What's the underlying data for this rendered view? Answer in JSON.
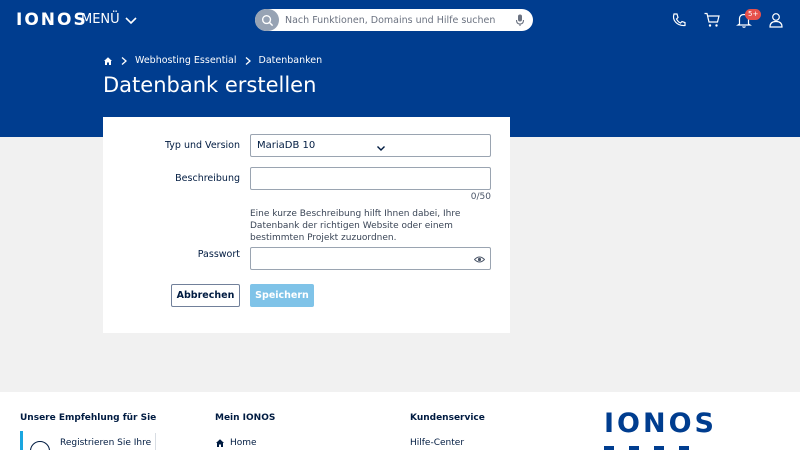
{
  "header": {
    "logo": "IONOS",
    "menu_label": "MENÜ",
    "search_placeholder": "Nach Funktionen, Domains und Hilfe suchen",
    "notification_badge": "5+"
  },
  "breadcrumb": {
    "items": [
      "Webhosting Essential",
      "Datenbanken"
    ]
  },
  "page": {
    "title": "Datenbank erstellen"
  },
  "form": {
    "type_label": "Typ und Version",
    "type_value": "MariaDB 10",
    "description_label": "Beschreibung",
    "description_value": "",
    "description_counter": "0/50",
    "description_help": "Eine kurze Beschreibung hilft Ihnen dabei, Ihre Datenbank der richtigen Website oder einem bestimmten Projekt zuzuordnen.",
    "password_label": "Passwort",
    "password_value": "",
    "cancel_label": "Abbrechen",
    "save_label": "Speichern"
  },
  "footer": {
    "col1_heading": "Unsere Empfehlung für Sie",
    "col1_item": "Registrieren Sie Ihre",
    "col2_heading": "Mein IONOS",
    "col2_item": "Home",
    "col3_heading": "Kundenservice",
    "col3_item": "Hilfe-Center",
    "logo": "IONOS"
  },
  "colors": {
    "brand_blue": "#003d8f",
    "accent_cyan": "#1aa6e0",
    "save_disabled": "#7fc3e8",
    "badge_red": "#e6504b"
  },
  "icons": [
    "chevron-down-icon",
    "search-icon",
    "microphone-icon",
    "phone-icon",
    "cart-icon",
    "bell-icon",
    "user-icon",
    "home-icon",
    "chevron-right-icon",
    "eye-icon"
  ]
}
